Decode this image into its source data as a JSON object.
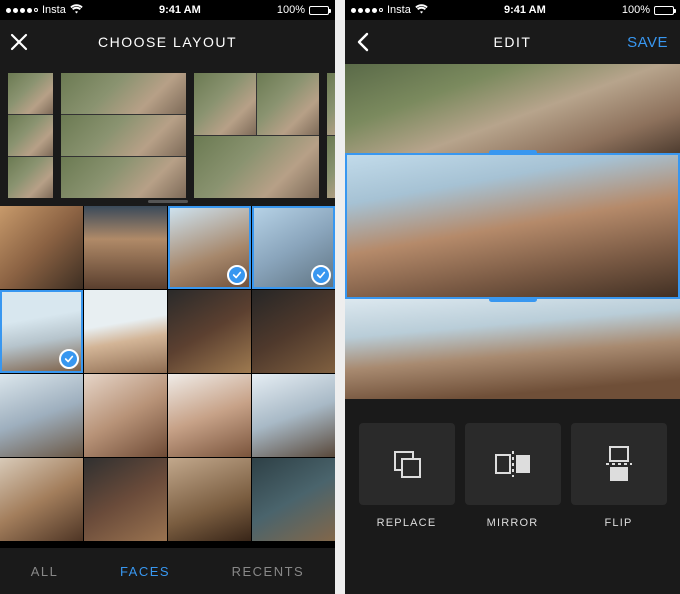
{
  "status": {
    "carrier": "Insta",
    "time": "9:41 AM",
    "battery_pct": "100%"
  },
  "left": {
    "title": "CHOOSE LAYOUT",
    "tabs": {
      "all": "ALL",
      "faces": "FACES",
      "recents": "RECENTS"
    }
  },
  "right": {
    "title": "EDIT",
    "save": "SAVE",
    "tools": {
      "replace": "REPLACE",
      "mirror": "MIRROR",
      "flip": "FLIP"
    }
  }
}
